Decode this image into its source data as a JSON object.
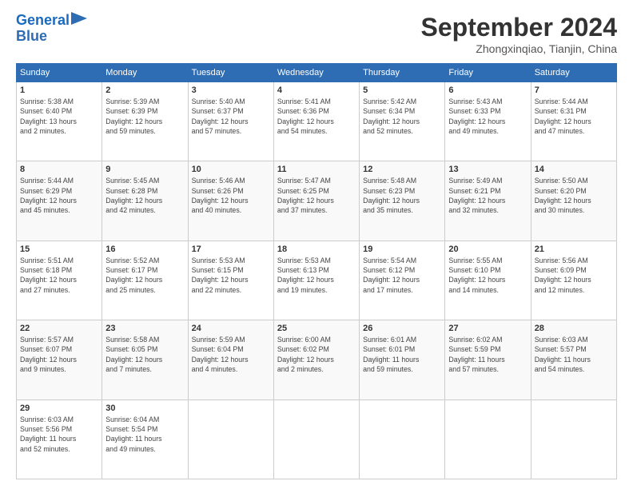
{
  "header": {
    "logo_line1": "General",
    "logo_line2": "Blue",
    "title": "September 2024",
    "location": "Zhongxinqiao, Tianjin, China"
  },
  "weekdays": [
    "Sunday",
    "Monday",
    "Tuesday",
    "Wednesday",
    "Thursday",
    "Friday",
    "Saturday"
  ],
  "weeks": [
    [
      {
        "day": "1",
        "info": "Sunrise: 5:38 AM\nSunset: 6:40 PM\nDaylight: 13 hours\nand 2 minutes."
      },
      {
        "day": "2",
        "info": "Sunrise: 5:39 AM\nSunset: 6:39 PM\nDaylight: 12 hours\nand 59 minutes."
      },
      {
        "day": "3",
        "info": "Sunrise: 5:40 AM\nSunset: 6:37 PM\nDaylight: 12 hours\nand 57 minutes."
      },
      {
        "day": "4",
        "info": "Sunrise: 5:41 AM\nSunset: 6:36 PM\nDaylight: 12 hours\nand 54 minutes."
      },
      {
        "day": "5",
        "info": "Sunrise: 5:42 AM\nSunset: 6:34 PM\nDaylight: 12 hours\nand 52 minutes."
      },
      {
        "day": "6",
        "info": "Sunrise: 5:43 AM\nSunset: 6:33 PM\nDaylight: 12 hours\nand 49 minutes."
      },
      {
        "day": "7",
        "info": "Sunrise: 5:44 AM\nSunset: 6:31 PM\nDaylight: 12 hours\nand 47 minutes."
      }
    ],
    [
      {
        "day": "8",
        "info": "Sunrise: 5:44 AM\nSunset: 6:29 PM\nDaylight: 12 hours\nand 45 minutes."
      },
      {
        "day": "9",
        "info": "Sunrise: 5:45 AM\nSunset: 6:28 PM\nDaylight: 12 hours\nand 42 minutes."
      },
      {
        "day": "10",
        "info": "Sunrise: 5:46 AM\nSunset: 6:26 PM\nDaylight: 12 hours\nand 40 minutes."
      },
      {
        "day": "11",
        "info": "Sunrise: 5:47 AM\nSunset: 6:25 PM\nDaylight: 12 hours\nand 37 minutes."
      },
      {
        "day": "12",
        "info": "Sunrise: 5:48 AM\nSunset: 6:23 PM\nDaylight: 12 hours\nand 35 minutes."
      },
      {
        "day": "13",
        "info": "Sunrise: 5:49 AM\nSunset: 6:21 PM\nDaylight: 12 hours\nand 32 minutes."
      },
      {
        "day": "14",
        "info": "Sunrise: 5:50 AM\nSunset: 6:20 PM\nDaylight: 12 hours\nand 30 minutes."
      }
    ],
    [
      {
        "day": "15",
        "info": "Sunrise: 5:51 AM\nSunset: 6:18 PM\nDaylight: 12 hours\nand 27 minutes."
      },
      {
        "day": "16",
        "info": "Sunrise: 5:52 AM\nSunset: 6:17 PM\nDaylight: 12 hours\nand 25 minutes."
      },
      {
        "day": "17",
        "info": "Sunrise: 5:53 AM\nSunset: 6:15 PM\nDaylight: 12 hours\nand 22 minutes."
      },
      {
        "day": "18",
        "info": "Sunrise: 5:53 AM\nSunset: 6:13 PM\nDaylight: 12 hours\nand 19 minutes."
      },
      {
        "day": "19",
        "info": "Sunrise: 5:54 AM\nSunset: 6:12 PM\nDaylight: 12 hours\nand 17 minutes."
      },
      {
        "day": "20",
        "info": "Sunrise: 5:55 AM\nSunset: 6:10 PM\nDaylight: 12 hours\nand 14 minutes."
      },
      {
        "day": "21",
        "info": "Sunrise: 5:56 AM\nSunset: 6:09 PM\nDaylight: 12 hours\nand 12 minutes."
      }
    ],
    [
      {
        "day": "22",
        "info": "Sunrise: 5:57 AM\nSunset: 6:07 PM\nDaylight: 12 hours\nand 9 minutes."
      },
      {
        "day": "23",
        "info": "Sunrise: 5:58 AM\nSunset: 6:05 PM\nDaylight: 12 hours\nand 7 minutes."
      },
      {
        "day": "24",
        "info": "Sunrise: 5:59 AM\nSunset: 6:04 PM\nDaylight: 12 hours\nand 4 minutes."
      },
      {
        "day": "25",
        "info": "Sunrise: 6:00 AM\nSunset: 6:02 PM\nDaylight: 12 hours\nand 2 minutes."
      },
      {
        "day": "26",
        "info": "Sunrise: 6:01 AM\nSunset: 6:01 PM\nDaylight: 11 hours\nand 59 minutes."
      },
      {
        "day": "27",
        "info": "Sunrise: 6:02 AM\nSunset: 5:59 PM\nDaylight: 11 hours\nand 57 minutes."
      },
      {
        "day": "28",
        "info": "Sunrise: 6:03 AM\nSunset: 5:57 PM\nDaylight: 11 hours\nand 54 minutes."
      }
    ],
    [
      {
        "day": "29",
        "info": "Sunrise: 6:03 AM\nSunset: 5:56 PM\nDaylight: 11 hours\nand 52 minutes."
      },
      {
        "day": "30",
        "info": "Sunrise: 6:04 AM\nSunset: 5:54 PM\nDaylight: 11 hours\nand 49 minutes."
      },
      {
        "day": "",
        "info": ""
      },
      {
        "day": "",
        "info": ""
      },
      {
        "day": "",
        "info": ""
      },
      {
        "day": "",
        "info": ""
      },
      {
        "day": "",
        "info": ""
      }
    ]
  ]
}
